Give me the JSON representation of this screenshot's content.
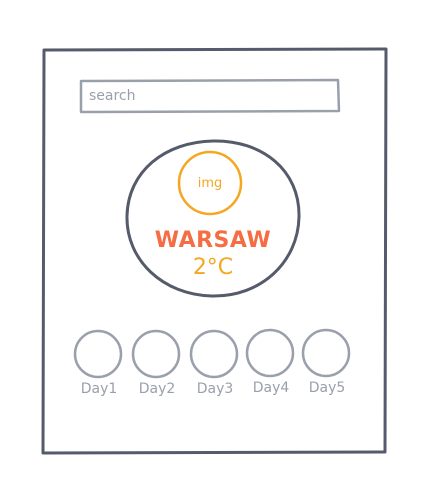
{
  "search": {
    "placeholder": "search"
  },
  "current": {
    "icon_text": "img",
    "city": "WARSAW",
    "temperature": "2°C"
  },
  "forecast": {
    "days": [
      {
        "label": "Day1"
      },
      {
        "label": "Day2"
      },
      {
        "label": "Day3"
      },
      {
        "label": "Day4"
      },
      {
        "label": "Day5"
      }
    ]
  },
  "colors": {
    "frame": "#555b6b",
    "muted": "#9aa0ab",
    "city": "#f46d43",
    "accent": "#f5a623"
  }
}
